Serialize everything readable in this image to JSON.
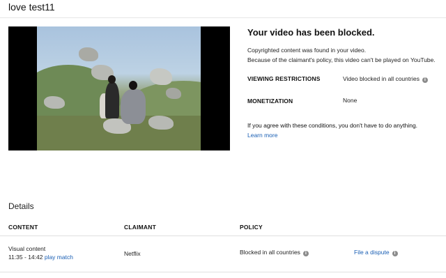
{
  "video": {
    "title": "love test11"
  },
  "blocked": {
    "heading": "Your video has been blocked.",
    "line1": "Copyrighted content was found in your video.",
    "line2": "Because of the claimant's policy, this video can't be played on YouTube.",
    "viewing_label": "VIEWING RESTRICTIONS",
    "viewing_value": "Video blocked in all countries",
    "monetization_label": "MONETIZATION",
    "monetization_value": "None",
    "agree_text": "If you agree with these conditions, you don't have to do anything.",
    "learn_more": "Learn more"
  },
  "details": {
    "heading": "Details",
    "columns": [
      "CONTENT",
      "CLAIMANT",
      "POLICY"
    ],
    "rows": [
      {
        "content_type": "Visual content",
        "time_range": "11:35 - 14:42",
        "play_match": "play match",
        "claimant": "Netflix",
        "policy": "Blocked in all countries",
        "action": "File a dispute"
      }
    ]
  },
  "icons": {
    "info": "i"
  },
  "colors": {
    "link": "#1a5fb4",
    "info_icon": "#8c8c8c"
  }
}
